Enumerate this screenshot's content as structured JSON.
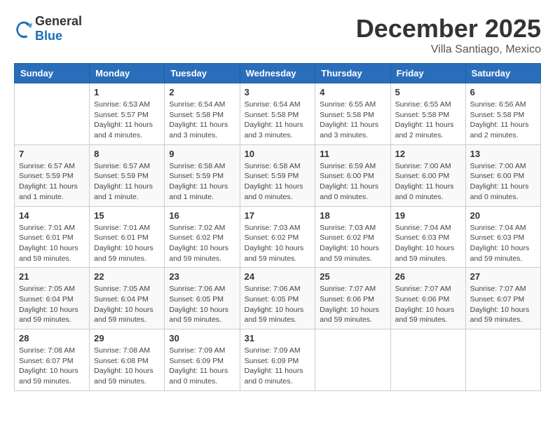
{
  "header": {
    "logo_general": "General",
    "logo_blue": "Blue",
    "month": "December 2025",
    "location": "Villa Santiago, Mexico"
  },
  "weekdays": [
    "Sunday",
    "Monday",
    "Tuesday",
    "Wednesday",
    "Thursday",
    "Friday",
    "Saturday"
  ],
  "weeks": [
    [
      {
        "day": "",
        "info": ""
      },
      {
        "day": "1",
        "info": "Sunrise: 6:53 AM\nSunset: 5:57 PM\nDaylight: 11 hours\nand 4 minutes."
      },
      {
        "day": "2",
        "info": "Sunrise: 6:54 AM\nSunset: 5:58 PM\nDaylight: 11 hours\nand 3 minutes."
      },
      {
        "day": "3",
        "info": "Sunrise: 6:54 AM\nSunset: 5:58 PM\nDaylight: 11 hours\nand 3 minutes."
      },
      {
        "day": "4",
        "info": "Sunrise: 6:55 AM\nSunset: 5:58 PM\nDaylight: 11 hours\nand 3 minutes."
      },
      {
        "day": "5",
        "info": "Sunrise: 6:55 AM\nSunset: 5:58 PM\nDaylight: 11 hours\nand 2 minutes."
      },
      {
        "day": "6",
        "info": "Sunrise: 6:56 AM\nSunset: 5:58 PM\nDaylight: 11 hours\nand 2 minutes."
      }
    ],
    [
      {
        "day": "7",
        "info": "Sunrise: 6:57 AM\nSunset: 5:59 PM\nDaylight: 11 hours\nand 1 minute."
      },
      {
        "day": "8",
        "info": "Sunrise: 6:57 AM\nSunset: 5:59 PM\nDaylight: 11 hours\nand 1 minute."
      },
      {
        "day": "9",
        "info": "Sunrise: 6:58 AM\nSunset: 5:59 PM\nDaylight: 11 hours\nand 1 minute."
      },
      {
        "day": "10",
        "info": "Sunrise: 6:58 AM\nSunset: 5:59 PM\nDaylight: 11 hours\nand 0 minutes."
      },
      {
        "day": "11",
        "info": "Sunrise: 6:59 AM\nSunset: 6:00 PM\nDaylight: 11 hours\nand 0 minutes."
      },
      {
        "day": "12",
        "info": "Sunrise: 7:00 AM\nSunset: 6:00 PM\nDaylight: 11 hours\nand 0 minutes."
      },
      {
        "day": "13",
        "info": "Sunrise: 7:00 AM\nSunset: 6:00 PM\nDaylight: 11 hours\nand 0 minutes."
      }
    ],
    [
      {
        "day": "14",
        "info": "Sunrise: 7:01 AM\nSunset: 6:01 PM\nDaylight: 10 hours\nand 59 minutes."
      },
      {
        "day": "15",
        "info": "Sunrise: 7:01 AM\nSunset: 6:01 PM\nDaylight: 10 hours\nand 59 minutes."
      },
      {
        "day": "16",
        "info": "Sunrise: 7:02 AM\nSunset: 6:02 PM\nDaylight: 10 hours\nand 59 minutes."
      },
      {
        "day": "17",
        "info": "Sunrise: 7:03 AM\nSunset: 6:02 PM\nDaylight: 10 hours\nand 59 minutes."
      },
      {
        "day": "18",
        "info": "Sunrise: 7:03 AM\nSunset: 6:02 PM\nDaylight: 10 hours\nand 59 minutes."
      },
      {
        "day": "19",
        "info": "Sunrise: 7:04 AM\nSunset: 6:03 PM\nDaylight: 10 hours\nand 59 minutes."
      },
      {
        "day": "20",
        "info": "Sunrise: 7:04 AM\nSunset: 6:03 PM\nDaylight: 10 hours\nand 59 minutes."
      }
    ],
    [
      {
        "day": "21",
        "info": "Sunrise: 7:05 AM\nSunset: 6:04 PM\nDaylight: 10 hours\nand 59 minutes."
      },
      {
        "day": "22",
        "info": "Sunrise: 7:05 AM\nSunset: 6:04 PM\nDaylight: 10 hours\nand 59 minutes."
      },
      {
        "day": "23",
        "info": "Sunrise: 7:06 AM\nSunset: 6:05 PM\nDaylight: 10 hours\nand 59 minutes."
      },
      {
        "day": "24",
        "info": "Sunrise: 7:06 AM\nSunset: 6:05 PM\nDaylight: 10 hours\nand 59 minutes."
      },
      {
        "day": "25",
        "info": "Sunrise: 7:07 AM\nSunset: 6:06 PM\nDaylight: 10 hours\nand 59 minutes."
      },
      {
        "day": "26",
        "info": "Sunrise: 7:07 AM\nSunset: 6:06 PM\nDaylight: 10 hours\nand 59 minutes."
      },
      {
        "day": "27",
        "info": "Sunrise: 7:07 AM\nSunset: 6:07 PM\nDaylight: 10 hours\nand 59 minutes."
      }
    ],
    [
      {
        "day": "28",
        "info": "Sunrise: 7:08 AM\nSunset: 6:07 PM\nDaylight: 10 hours\nand 59 minutes."
      },
      {
        "day": "29",
        "info": "Sunrise: 7:08 AM\nSunset: 6:08 PM\nDaylight: 10 hours\nand 59 minutes."
      },
      {
        "day": "30",
        "info": "Sunrise: 7:09 AM\nSunset: 6:09 PM\nDaylight: 11 hours\nand 0 minutes."
      },
      {
        "day": "31",
        "info": "Sunrise: 7:09 AM\nSunset: 6:09 PM\nDaylight: 11 hours\nand 0 minutes."
      },
      {
        "day": "",
        "info": ""
      },
      {
        "day": "",
        "info": ""
      },
      {
        "day": "",
        "info": ""
      }
    ]
  ]
}
